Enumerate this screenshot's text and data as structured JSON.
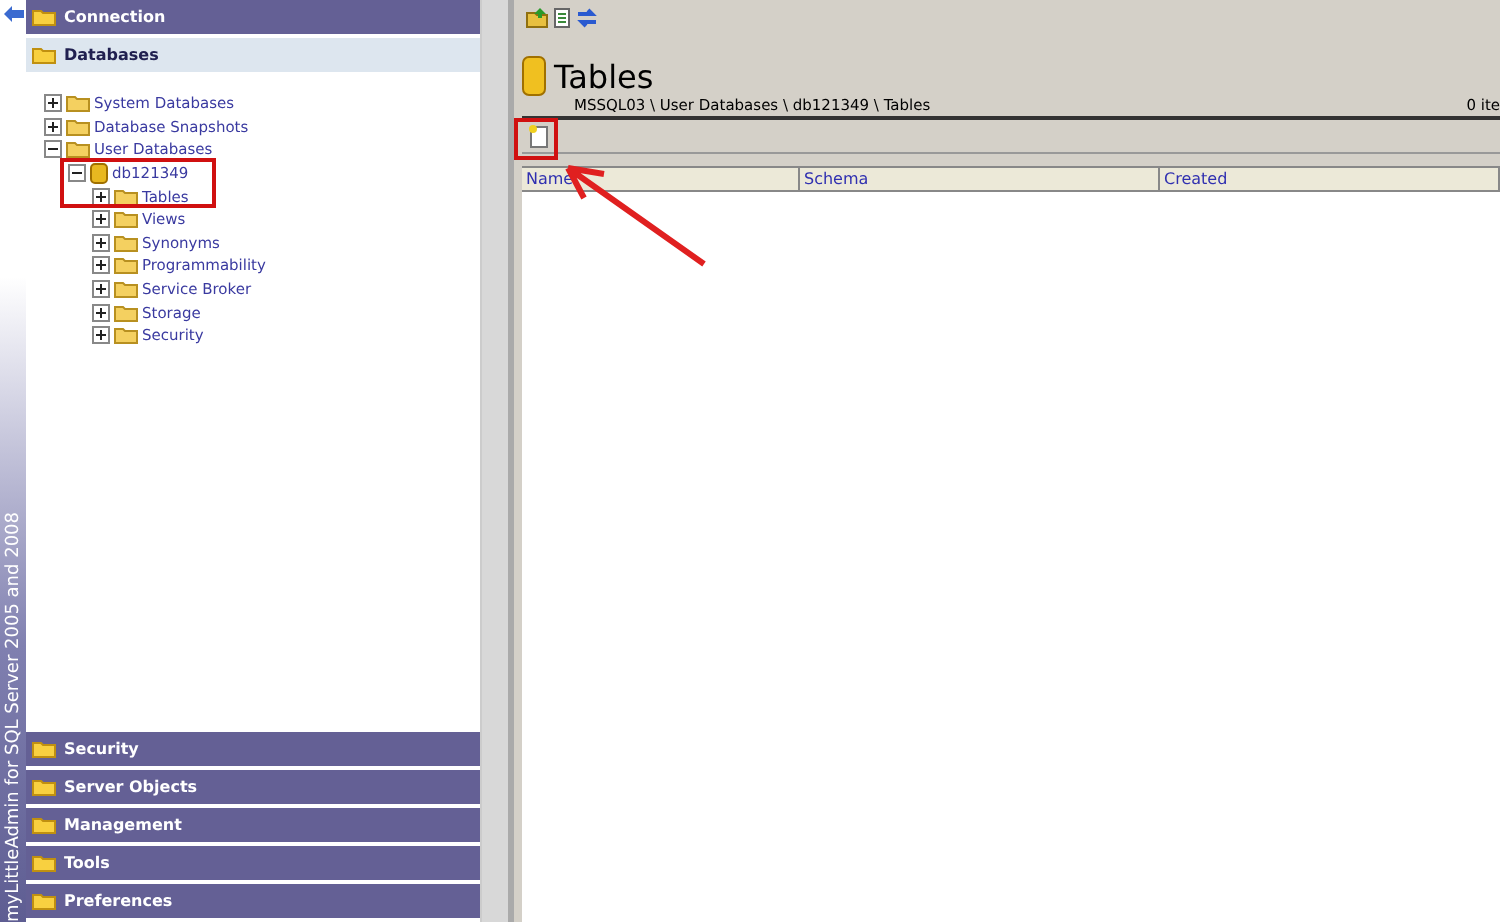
{
  "side_caption": "myLittleAdmin for SQL Server 2005 and 2008",
  "top_sections": [
    {
      "label": "Connection",
      "expanded": false
    },
    {
      "label": "Databases",
      "expanded": true
    }
  ],
  "tree": [
    {
      "label": "System Databases",
      "kind": "folder",
      "expanded": false
    },
    {
      "label": "Database Snapshots",
      "kind": "folder",
      "expanded": false
    },
    {
      "label": "User Databases",
      "kind": "folder",
      "expanded": true,
      "children": [
        {
          "label": "db121349",
          "kind": "database",
          "expanded": true,
          "children": [
            {
              "label": "Tables",
              "kind": "folder",
              "expanded": false
            },
            {
              "label": "Views",
              "kind": "folder",
              "expanded": false
            },
            {
              "label": "Synonyms",
              "kind": "folder",
              "expanded": false
            },
            {
              "label": "Programmability",
              "kind": "folder",
              "expanded": false
            },
            {
              "label": "Service Broker",
              "kind": "folder",
              "expanded": false
            },
            {
              "label": "Storage",
              "kind": "folder",
              "expanded": false
            },
            {
              "label": "Security",
              "kind": "folder",
              "expanded": false
            }
          ]
        }
      ]
    }
  ],
  "bottom_sections": [
    {
      "label": "Security",
      "expanded": false
    },
    {
      "label": "Server Objects",
      "expanded": false
    },
    {
      "label": "Management",
      "expanded": false
    },
    {
      "label": "Tools",
      "expanded": false
    },
    {
      "label": "Preferences",
      "expanded": false
    }
  ],
  "page": {
    "title": "Tables",
    "breadcrumb": "MSSQL03 \\ User Databases \\ db121349 \\ Tables",
    "count": "0 ite"
  },
  "table": {
    "columns": [
      "Name",
      "Schema",
      "Created"
    ]
  }
}
